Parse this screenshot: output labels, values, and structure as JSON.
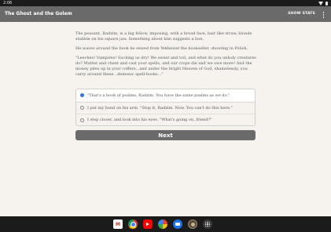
{
  "status_bar": {
    "time": "2:06",
    "icons": [
      "wifi-icon",
      "battery-icon"
    ]
  },
  "app_bar": {
    "title": "The Ghost and the Golem",
    "show_stats_label": "SHOW STATS",
    "menu_icon": "more-vert-icon"
  },
  "story": {
    "paragraphs": [
      "The peasant, Radzim, is a big fellow, imposing, with a broad face, hair like straw, blonde stubble on his square jaw. Something about him suggests a lion.",
      "He waves around the book he seized from Yekheziel the bookseller, shouting in Polish.",
      "\"Leeches! Vampires! Sucking us dry! We sweat and toil, and what do you unholy creatures do? Mutter and chant and cast your spells, and our crops die and we owe more! And the money piles up in your coffers...and under the bright Heaven of God, shamelessly, you carry around these...demonic spell-books...\""
    ]
  },
  "choices": {
    "selected_index": 0,
    "options": [
      "\"That's a book of psalms, Radzim. You have the same psalms as we do.\"",
      "I put my hand on his arm. \"Stop it, Radzim. Now. You can't do this here.\"",
      "I step closer, and look into his eyes. \"What's going on, friend?\""
    ]
  },
  "next_button": {
    "label": "Next"
  },
  "taskbar": {
    "apps": [
      "gmail-icon",
      "chrome-icon",
      "youtube-icon",
      "photos-icon",
      "messages-icon",
      "game-icon",
      "app-launcher-icon"
    ],
    "gmail_glyph": "M"
  }
}
